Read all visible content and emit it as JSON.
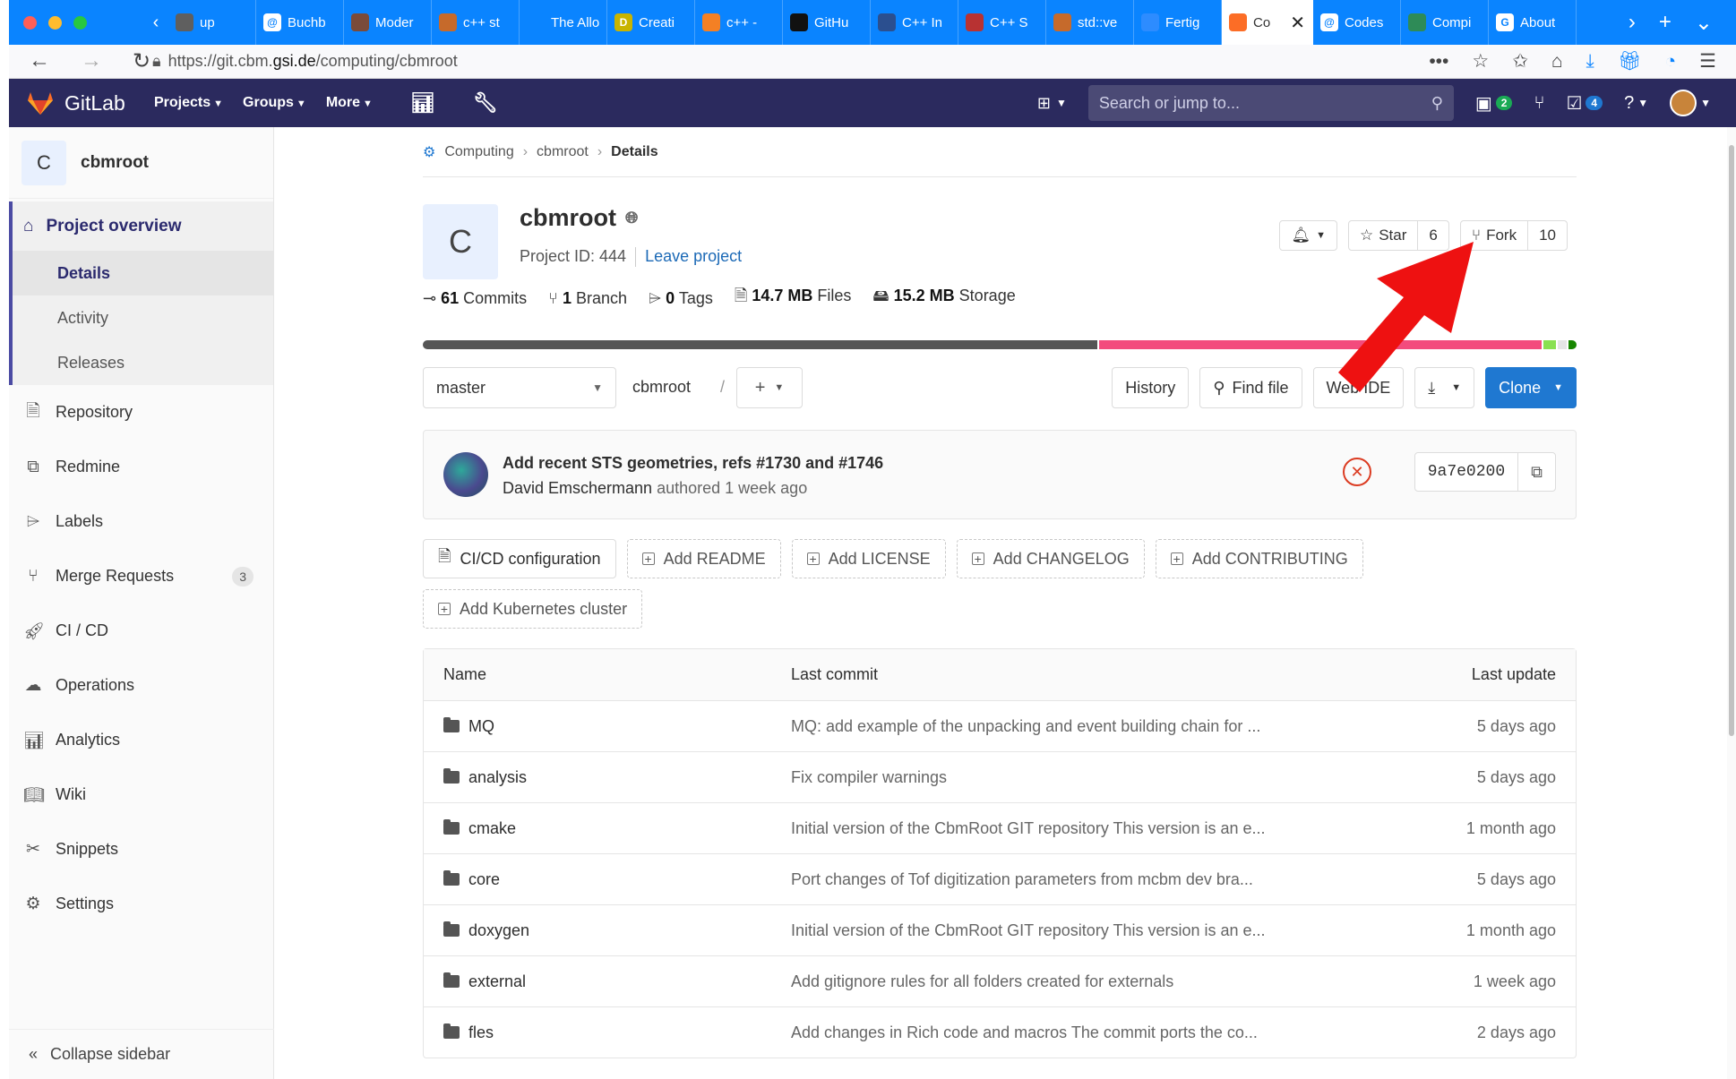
{
  "browser": {
    "tabs": [
      {
        "label": "up",
        "fav_color": "#5f5f5f",
        "fav": ""
      },
      {
        "label": "Buchb",
        "fav_color": "#ffffff",
        "fav": "@"
      },
      {
        "label": "Moder",
        "fav_color": "#7a4b3a",
        "fav": ""
      },
      {
        "label": "c++ st",
        "fav_color": "#c66a2b",
        "fav": ""
      },
      {
        "label": "The Alloca",
        "fav_color": "#0a84ff",
        "fav": ""
      },
      {
        "label": "Creati",
        "fav_color": "#c8b400",
        "fav": "D"
      },
      {
        "label": "c++ -",
        "fav_color": "#f48024",
        "fav": ""
      },
      {
        "label": "GitHu",
        "fav_color": "#111111",
        "fav": ""
      },
      {
        "label": "C++ In",
        "fav_color": "#2b4f8f",
        "fav": ""
      },
      {
        "label": "C++ S",
        "fav_color": "#b83232",
        "fav": ""
      },
      {
        "label": "std::ve",
        "fav_color": "#c66a2b",
        "fav": ""
      },
      {
        "label": "Fertig",
        "fav_color": "#2d8cff",
        "fav": ""
      },
      {
        "label": "Co",
        "fav_color": "#fc6d26",
        "fav": "",
        "active": true
      },
      {
        "label": "Codes",
        "fav_color": "#ffffff",
        "fav": "@"
      },
      {
        "label": "Compi",
        "fav_color": "#2e8b57",
        "fav": ""
      },
      {
        "label": "About",
        "fav_color": "#ffffff",
        "fav": "G"
      }
    ],
    "url_prefix": "https://git.cbm.",
    "url_domain": "gsi.de",
    "url_path": "/computing/cbmroot"
  },
  "gitlab_nav": {
    "brand": "GitLab",
    "projects": "Projects",
    "groups": "Groups",
    "more": "More",
    "search_placeholder": "Search or jump to...",
    "todo_count": "2",
    "issues_count": "4"
  },
  "sidebar": {
    "project_initial": "C",
    "project_name": "cbmroot",
    "overview_title": "Project overview",
    "overview_items": [
      "Details",
      "Activity",
      "Releases"
    ],
    "items": [
      {
        "label": "Repository",
        "icon": "repository-icon"
      },
      {
        "label": "Redmine",
        "icon": "external-link-icon"
      },
      {
        "label": "Labels",
        "icon": "label-icon"
      },
      {
        "label": "Merge Requests",
        "icon": "merge-request-icon",
        "count": "3"
      },
      {
        "label": "CI / CD",
        "icon": "rocket-icon"
      },
      {
        "label": "Operations",
        "icon": "cloud-gear-icon"
      },
      {
        "label": "Analytics",
        "icon": "chart-icon"
      },
      {
        "label": "Wiki",
        "icon": "book-icon"
      },
      {
        "label": "Snippets",
        "icon": "scissors-icon"
      },
      {
        "label": "Settings",
        "icon": "gear-icon"
      }
    ],
    "collapse": "Collapse sidebar"
  },
  "breadcrumb": {
    "group": "Computing",
    "project": "cbmroot",
    "current": "Details"
  },
  "project": {
    "initial": "C",
    "name": "cbmroot",
    "id_text": "Project ID: 444",
    "leave": "Leave project",
    "star_label": "Star",
    "star_count": "6",
    "fork_label": "Fork",
    "fork_count": "10",
    "stats": {
      "commits_num": "61",
      "commits_lbl": "Commits",
      "branch_num": "1",
      "branch_lbl": "Branch",
      "tags_num": "0",
      "tags_lbl": "Tags",
      "files_num": "14.7 MB",
      "files_lbl": "Files",
      "storage_num": "15.2 MB",
      "storage_lbl": "Storage"
    },
    "languages": [
      {
        "share": 58.6,
        "color": "#555555"
      },
      {
        "share": 38.4,
        "color": "#f34b7d"
      },
      {
        "share": 1.1,
        "color": "#89e051"
      },
      {
        "share": 0.8,
        "color": "#e5e5e5"
      },
      {
        "share": 0.7,
        "color": "#178600"
      }
    ]
  },
  "toolbar": {
    "branch": "master",
    "path": "cbmroot",
    "history": "History",
    "find_file": "Find file",
    "web_ide": "Web IDE",
    "clone": "Clone"
  },
  "last_commit": {
    "title": "Add recent STS geometries, refs #1730 and #1746",
    "author": "David Emschermann",
    "when": "authored 1 week ago",
    "sha": "9a7e0200"
  },
  "add_buttons": [
    "CI/CD configuration",
    "Add README",
    "Add LICENSE",
    "Add CHANGELOG",
    "Add CONTRIBUTING",
    "Add Kubernetes cluster"
  ],
  "file_table": {
    "headers": {
      "name": "Name",
      "commit": "Last commit",
      "update": "Last update"
    },
    "rows": [
      {
        "name": "MQ",
        "commit": "MQ: add example of the unpacking and event building chain for ...",
        "update": "5 days ago"
      },
      {
        "name": "analysis",
        "commit": "Fix compiler warnings",
        "update": "5 days ago"
      },
      {
        "name": "cmake",
        "commit": "Initial version of the CbmRoot GIT repository This version is an e...",
        "update": "1 month ago"
      },
      {
        "name": "core",
        "commit": "Port changes of Tof digitization parameters from mcbm dev bra...",
        "update": "5 days ago"
      },
      {
        "name": "doxygen",
        "commit": "Initial version of the CbmRoot GIT repository This version is an e...",
        "update": "1 month ago"
      },
      {
        "name": "external",
        "commit": "Add gitignore rules for all folders created for externals",
        "update": "1 week ago"
      },
      {
        "name": "fles",
        "commit": "Add changes in Rich code and macros The commit ports the co...",
        "update": "2 days ago"
      }
    ]
  },
  "annotation": {
    "arrow_color": "#ee1111"
  }
}
